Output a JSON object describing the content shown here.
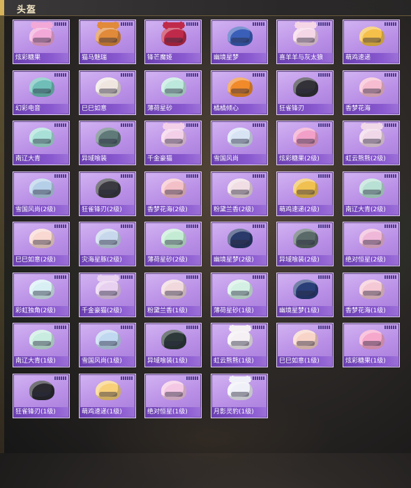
{
  "header": {
    "title": "头盔"
  },
  "colors": {
    "card_top": "#d2b3f2",
    "card_bottom": "#a47bd9",
    "label_bg": "#6a3fb0",
    "header_text": "#f3e7c4"
  },
  "helmets": [
    {
      "name": "炫彩糖果",
      "color": "#f2a9d8",
      "icon": "sheep-pink-helmet-icon"
    },
    {
      "name": "猫马魅瑞",
      "color": "#e08a3a",
      "icon": "cat-orange-helmet-icon"
    },
    {
      "name": "锋芒魔姬",
      "color": "#c02a4a",
      "icon": "demon-red-helmet-icon"
    },
    {
      "name": "幽境星梦",
      "color": "#3a5fb8",
      "icon": "mecha-blue-helmet-icon"
    },
    {
      "name": "喜羊羊与灰太狼",
      "color": "#f4d6e6",
      "icon": "sheep-white-helmet-icon"
    },
    {
      "name": "萌鸡速递",
      "color": "#f5c04a",
      "icon": "chick-yellow-helmet-icon"
    },
    {
      "name": "幻彩电音",
      "color": "#6fbfb8",
      "icon": "tech-teal-helmet-icon"
    },
    {
      "name": "巳巳如意",
      "color": "#f0e6e0",
      "icon": "snake-white-helmet-icon"
    },
    {
      "name": "薄荷星砂",
      "color": "#bde8dc",
      "icon": "mint-helmet-icon"
    },
    {
      "name": "橘橘倾心",
      "color": "#f08a2a",
      "icon": "orange-helmet-icon"
    },
    {
      "name": "狂雀锋刃",
      "color": "#333238",
      "icon": "black-bird-helmet-icon"
    },
    {
      "name": "香梦花海",
      "color": "#f6bcd0",
      "icon": "flower-pink-helmet-icon"
    },
    {
      "name": "南辽大青",
      "color": "#a8e0d8",
      "icon": "dragon-teal-helmet-icon"
    },
    {
      "name": "异域喰装",
      "color": "#5f7a78",
      "icon": "gas-mask-helmet-icon"
    },
    {
      "name": "千金豪猫",
      "color": "#f3d0e8",
      "icon": "cat-white-helmet-icon"
    },
    {
      "name": "雪国风尚",
      "color": "#d8e4f4",
      "icon": "snow-helmet-icon"
    },
    {
      "name": "炫彩糖果(2级)",
      "color": "#f2a0c8",
      "icon": "candy-helmet-icon"
    },
    {
      "name": "虹云熊熊(2级)",
      "color": "#f0d8e8",
      "icon": "bear-helmet-icon"
    },
    {
      "name": "雪国风尚(2级)",
      "color": "#b6cfe8",
      "icon": "snow-helmet-lv2-icon"
    },
    {
      "name": "狂雀锋刃(2级)",
      "color": "#3a3a40",
      "icon": "black-bird-helmet-lv2-icon"
    },
    {
      "name": "香梦花海(2级)",
      "color": "#f4c0c8",
      "icon": "flower-helmet-lv2-icon"
    },
    {
      "name": "粉黛兰香(2级)",
      "color": "#f0dee4",
      "icon": "pink-helmet-lv2-icon"
    },
    {
      "name": "萌鸡速递(2级)",
      "color": "#f0c050",
      "icon": "chick-helmet-lv2-icon"
    },
    {
      "name": "南辽大青(2级)",
      "color": "#b8e0d4",
      "icon": "dragon-helmet-lv2-icon"
    },
    {
      "name": "巳巳如意(2级)",
      "color": "#f8d8d0",
      "icon": "snake-helmet-lv2-icon"
    },
    {
      "name": "灾海星豚(2级)",
      "color": "#c8d8ec",
      "icon": "dolphin-helmet-lv2-icon"
    },
    {
      "name": "薄荷星砂(2级)",
      "color": "#c4ecd4",
      "icon": "mint-helmet-lv2-icon"
    },
    {
      "name": "幽境星梦(2级)",
      "color": "#2a3a6a",
      "icon": "mecha-helmet-lv2-icon"
    },
    {
      "name": "异域喰装(2级)",
      "color": "#5a6a68",
      "icon": "gas-mask-helmet-lv2-icon"
    },
    {
      "name": "绝对恒星(2级)",
      "color": "#f0b8d8",
      "icon": "star-helmet-lv2-icon"
    },
    {
      "name": "彩虹独角(2级)",
      "color": "#d8f0f4",
      "icon": "unicorn-helmet-lv2-icon"
    },
    {
      "name": "千金豪猫(2级)",
      "color": "#e8d0f0",
      "icon": "cat-helmet-lv2-icon"
    },
    {
      "name": "粉黛兰香(1级)",
      "color": "#f0d8dc",
      "icon": "pink-helmet-lv1-icon"
    },
    {
      "name": "薄荷星砂(1级)",
      "color": "#d4f0e4",
      "icon": "mint-helmet-lv1-icon"
    },
    {
      "name": "幽境星梦(1级)",
      "color": "#2a3e78",
      "icon": "mecha-helmet-lv1-icon"
    },
    {
      "name": "香梦花海(1级)",
      "color": "#f4c8d4",
      "icon": "flower-helmet-lv1-icon"
    },
    {
      "name": "南辽大青(1级)",
      "color": "#c8ece0",
      "icon": "dragon-helmet-lv1-icon"
    },
    {
      "name": "雪国风尚(1级)",
      "color": "#c0d8f0",
      "icon": "snow-helmet-lv1-icon"
    },
    {
      "name": "异域喰装(1级)",
      "color": "#2e3a3a",
      "icon": "gas-mask-helmet-lv1-icon"
    },
    {
      "name": "虹云熊熊(1级)",
      "color": "#f4f0f4",
      "icon": "bear-helmet-lv1-icon"
    },
    {
      "name": "巳巳如意(1级)",
      "color": "#f8d4c8",
      "icon": "snake-helmet-lv1-icon"
    },
    {
      "name": "炫彩糖果(1级)",
      "color": "#f6a8cc",
      "icon": "candy-helmet-lv1-icon"
    },
    {
      "name": "狂雀锋刃(1级)",
      "color": "#2a2a30",
      "icon": "black-bird-helmet-lv1-icon"
    },
    {
      "name": "萌鸡速递(1级)",
      "color": "#f8d07a",
      "icon": "chick-helmet-lv1-icon"
    },
    {
      "name": "绝对恒星(1级)",
      "color": "#f4c8e4",
      "icon": "star-helmet-lv1-icon"
    },
    {
      "name": "月影灵豹(1级)",
      "color": "#f0f0f8",
      "icon": "leopard-helmet-lv1-icon"
    }
  ]
}
